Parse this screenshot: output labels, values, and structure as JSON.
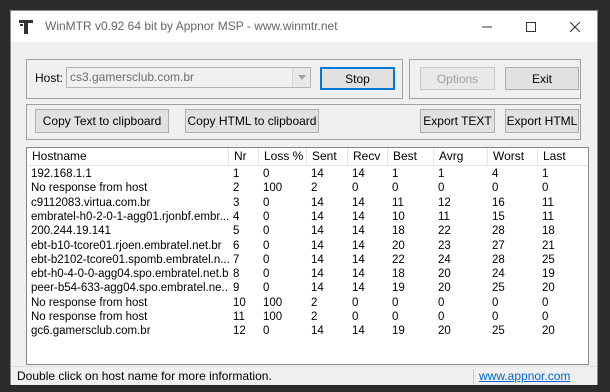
{
  "window": {
    "title": "WinMTR v0.92 64 bit by Appnor MSP - www.winmtr.net"
  },
  "host": {
    "label": "Host:",
    "value": "cs3.gamersclub.com.br",
    "stop_label": "Stop"
  },
  "options": {
    "options_label": "Options",
    "exit_label": "Exit"
  },
  "copy": {
    "copy_text_label": "Copy Text to clipboard",
    "copy_html_label": "Copy HTML to clipboard",
    "export_text_label": "Export TEXT",
    "export_html_label": "Export HTML"
  },
  "table": {
    "columns": [
      "Hostname",
      "Nr",
      "Loss %",
      "Sent",
      "Recv",
      "Best",
      "Avrg",
      "Worst",
      "Last"
    ],
    "rows": [
      [
        "192.168.1.1",
        "1",
        "0",
        "14",
        "14",
        "1",
        "1",
        "4",
        "1"
      ],
      [
        "No response from host",
        "2",
        "100",
        "2",
        "0",
        "0",
        "0",
        "0",
        "0"
      ],
      [
        "c9112083.virtua.com.br",
        "3",
        "0",
        "14",
        "14",
        "11",
        "12",
        "16",
        "11"
      ],
      [
        "embratel-h0-2-0-1-agg01.rjonbf.embr...",
        "4",
        "0",
        "14",
        "14",
        "10",
        "11",
        "15",
        "11"
      ],
      [
        "200.244.19.141",
        "5",
        "0",
        "14",
        "14",
        "18",
        "22",
        "28",
        "18"
      ],
      [
        "ebt-b10-tcore01.rjoen.embratel.net.br",
        "6",
        "0",
        "14",
        "14",
        "20",
        "23",
        "27",
        "21"
      ],
      [
        "ebt-b2102-tcore01.spomb.embratel.n...",
        "7",
        "0",
        "14",
        "14",
        "22",
        "24",
        "28",
        "25"
      ],
      [
        "ebt-h0-4-0-0-agg04.spo.embratel.net.br",
        "8",
        "0",
        "14",
        "14",
        "18",
        "20",
        "24",
        "19"
      ],
      [
        "peer-b54-633-agg04.spo.embratel.ne...",
        "9",
        "0",
        "14",
        "14",
        "19",
        "20",
        "25",
        "20"
      ],
      [
        "No response from host",
        "10",
        "100",
        "2",
        "0",
        "0",
        "0",
        "0",
        "0"
      ],
      [
        "No response from host",
        "11",
        "100",
        "2",
        "0",
        "0",
        "0",
        "0",
        "0"
      ],
      [
        "gc6.gamersclub.com.br",
        "12",
        "0",
        "14",
        "14",
        "19",
        "20",
        "25",
        "20"
      ]
    ]
  },
  "status": {
    "text": "Double click on host name for more information.",
    "link": "www.appnor.com"
  }
}
